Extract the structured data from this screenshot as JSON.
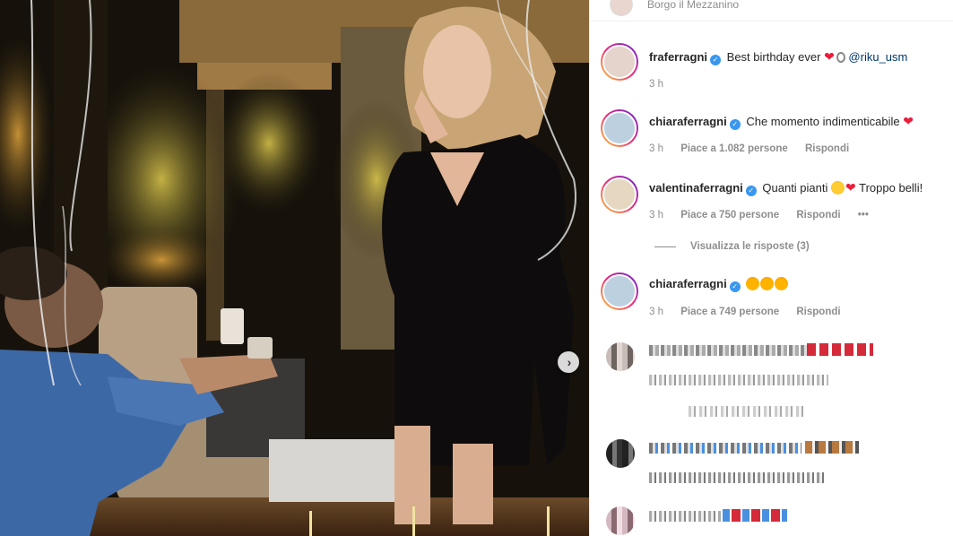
{
  "location": "Borgo il Mezzanino",
  "caption": {
    "username": "fraferragni",
    "text": "Best birthday ever",
    "mention": "@riku_usm",
    "time": "3 h"
  },
  "comments": [
    {
      "username": "chiaraferragni",
      "text": "Che momento indimenticabile",
      "time": "3 h",
      "likes": "Piace a 1.082 persone",
      "reply": "Rispondi"
    },
    {
      "username": "valentinaferragni",
      "text": "Quanti pianti",
      "text_after": "Troppo belli!",
      "time": "3 h",
      "likes": "Piace a 750 persone",
      "reply": "Rispondi",
      "more": "•••",
      "view_replies": "Visualizza le risposte (3)"
    },
    {
      "username": "chiaraferragni",
      "text": "",
      "time": "3 h",
      "likes": "Piace a 749 persone",
      "reply": "Rispondi"
    }
  ],
  "icons": {
    "verified": "verified-badge-icon",
    "next": "chevron-right-icon",
    "heart": "red-heart-emoji",
    "ring": "ring-emoji",
    "crying": "crying-face-emoji",
    "star_eyes": "star-struck-emoji"
  },
  "colors": {
    "verified": "#3897f0",
    "secondary_text": "#8e8e8e",
    "heart": "#ed1c3a"
  }
}
